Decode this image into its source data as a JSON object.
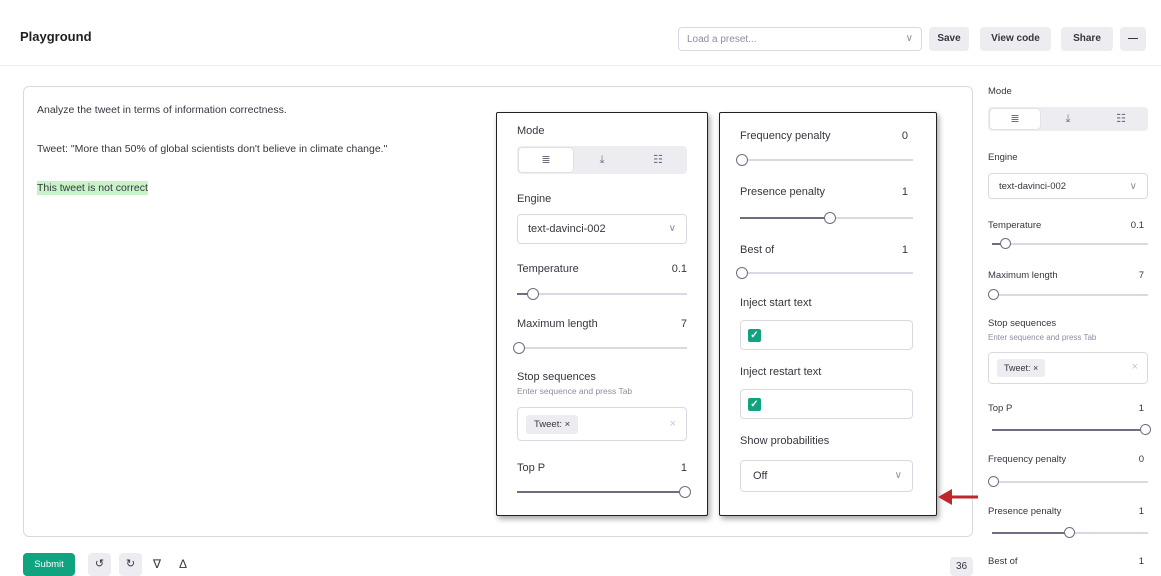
{
  "header": {
    "title": "Playground",
    "preset_placeholder": "Load a preset...",
    "save_label": "Save",
    "view_code_label": "View code",
    "share_label": "Share",
    "more_label": "—"
  },
  "editor": {
    "line1": "Analyze the tweet in terms of information correctness.",
    "line2": "Tweet: \"More than 50% of global scientists don't believe in climate change.\"",
    "completion": "This tweet is not correct"
  },
  "bottom": {
    "submit_label": "Submit",
    "token_count": "36"
  },
  "settings": {
    "mode_label": "Mode",
    "engine_label": "Engine",
    "engine_value": "text-davinci-002",
    "temperature_label": "Temperature",
    "temperature_value": "0.1",
    "temperature_fraction": 0.1,
    "max_length_label": "Maximum length",
    "max_length_value": "7",
    "stop_label": "Stop sequences",
    "stop_hint": "Enter sequence and press Tab",
    "stop_tag": "Tweet: ×",
    "top_p_label": "Top P",
    "top_p_value": "1",
    "freq_label": "Frequency penalty",
    "freq_value": "0",
    "presence_label": "Presence penalty",
    "presence_value": "1",
    "presence_fraction": 0.5,
    "best_of_label": "Best of",
    "best_of_value": "1",
    "inject_start_label": "Inject start text",
    "inject_restart_label": "Inject restart text",
    "show_prob_label": "Show probabilities",
    "show_prob_value": "Off"
  },
  "icons": {
    "mode_complete": "≣",
    "mode_insert": "⤓",
    "mode_edit": "☷",
    "chevron": "∨",
    "clear": "×",
    "check": "✓",
    "undo": "↺",
    "regenerate": "↻",
    "thumbs_down": "∇",
    "thumbs_up": "Δ"
  },
  "colors": {
    "accent": "#10a37f",
    "highlight": "#c8f2c8",
    "arrow": "#c0272d"
  }
}
